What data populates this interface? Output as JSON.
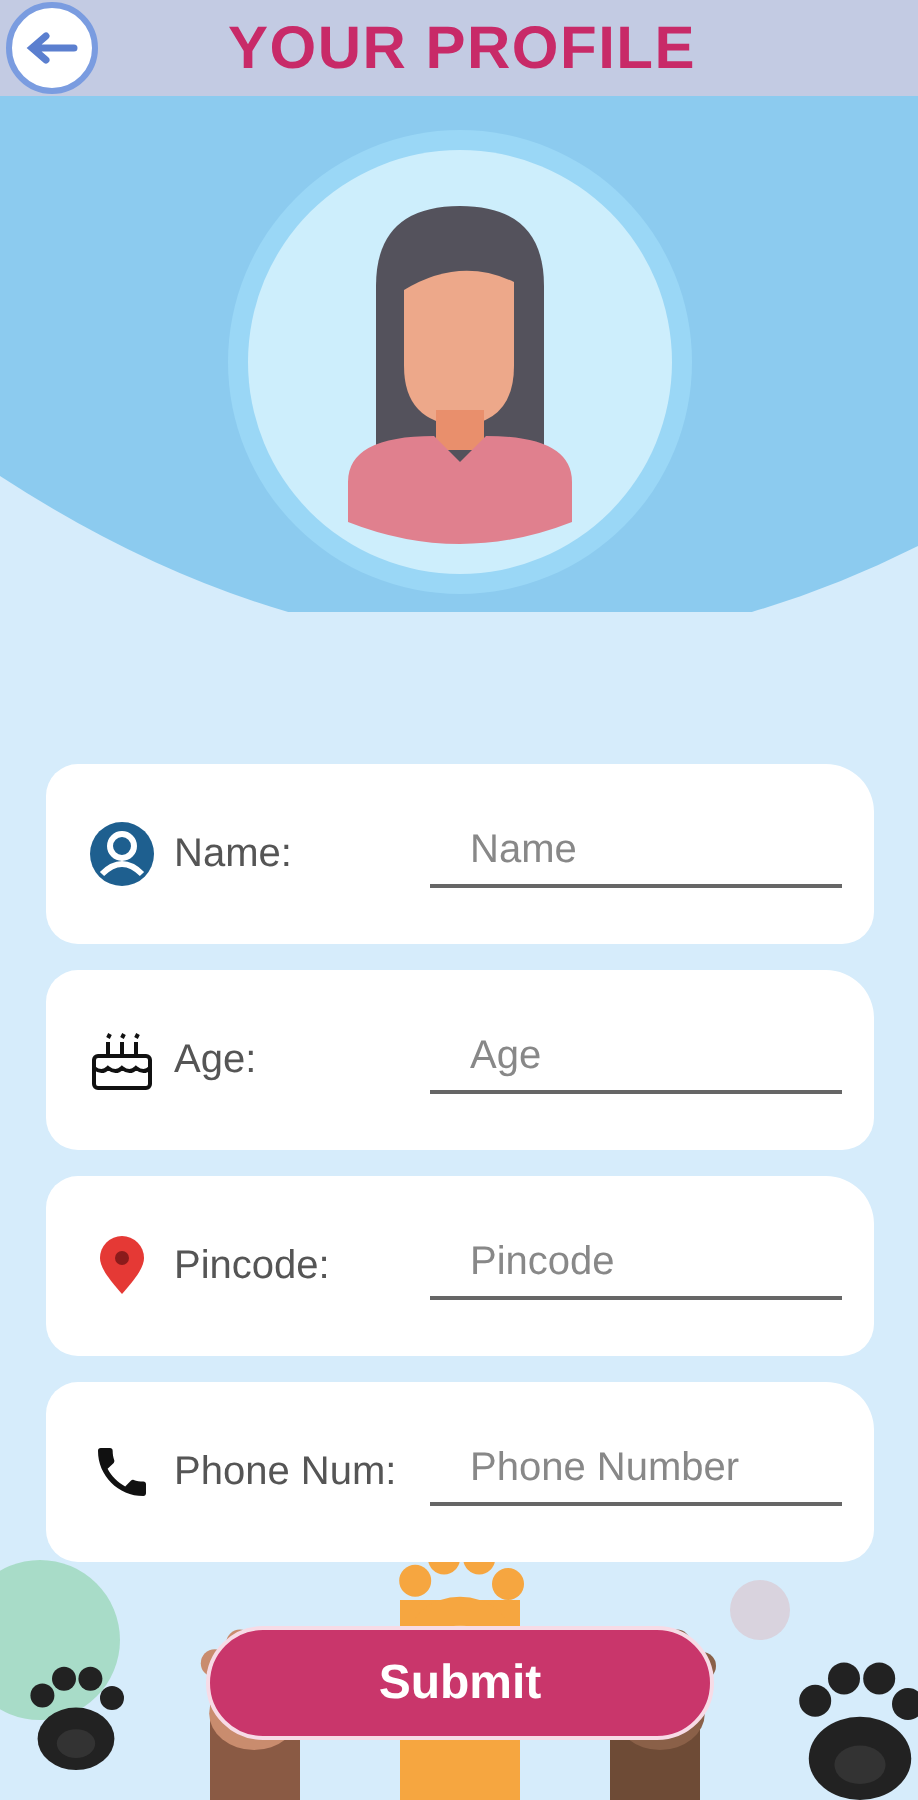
{
  "header": {
    "title": "YOUR PROFILE"
  },
  "fields": [
    {
      "label": "Name:",
      "placeholder": "Name"
    },
    {
      "label": "Age:",
      "placeholder": "Age"
    },
    {
      "label": "Pincode:",
      "placeholder": "Pincode"
    },
    {
      "label": "Phone Num:",
      "placeholder": "Phone Number"
    }
  ],
  "submit_button": "Submit"
}
